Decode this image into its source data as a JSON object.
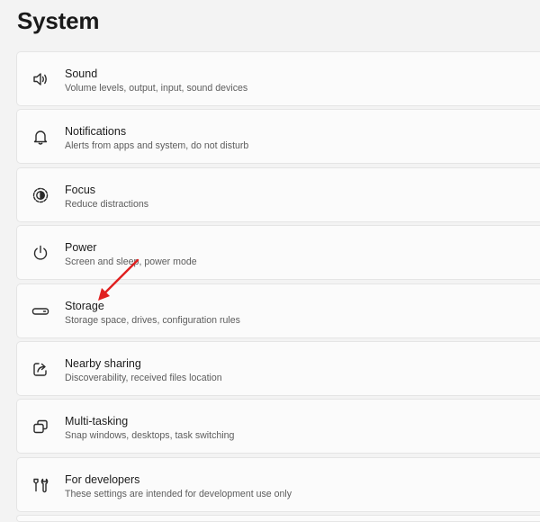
{
  "page": {
    "title": "System"
  },
  "settings": [
    {
      "key": "sound",
      "icon": "speaker-icon",
      "title": "Sound",
      "subtitle": "Volume levels, output, input, sound devices"
    },
    {
      "key": "notifications",
      "icon": "bell-icon",
      "title": "Notifications",
      "subtitle": "Alerts from apps and system, do not disturb"
    },
    {
      "key": "focus",
      "icon": "focus-icon",
      "title": "Focus",
      "subtitle": "Reduce distractions"
    },
    {
      "key": "power",
      "icon": "power-icon",
      "title": "Power",
      "subtitle": "Screen and sleep, power mode"
    },
    {
      "key": "storage",
      "icon": "storage-drive-icon",
      "title": "Storage",
      "subtitle": "Storage space, drives, configuration rules"
    },
    {
      "key": "nearby-sharing",
      "icon": "share-icon",
      "title": "Nearby sharing",
      "subtitle": "Discoverability, received files location"
    },
    {
      "key": "multi-tasking",
      "icon": "multitask-windows-icon",
      "title": "Multi-tasking",
      "subtitle": "Snap windows, desktops, task switching"
    },
    {
      "key": "for-developers",
      "icon": "developer-tools-icon",
      "title": "For developers",
      "subtitle": "These settings are intended for development use only"
    }
  ],
  "colors": {
    "background": "#f3f3f3",
    "card": "#fbfbfb",
    "card_border": "#e5e5e5",
    "subtitle_text": "#5d5d5d",
    "annotation_arrow": "#e02020"
  }
}
